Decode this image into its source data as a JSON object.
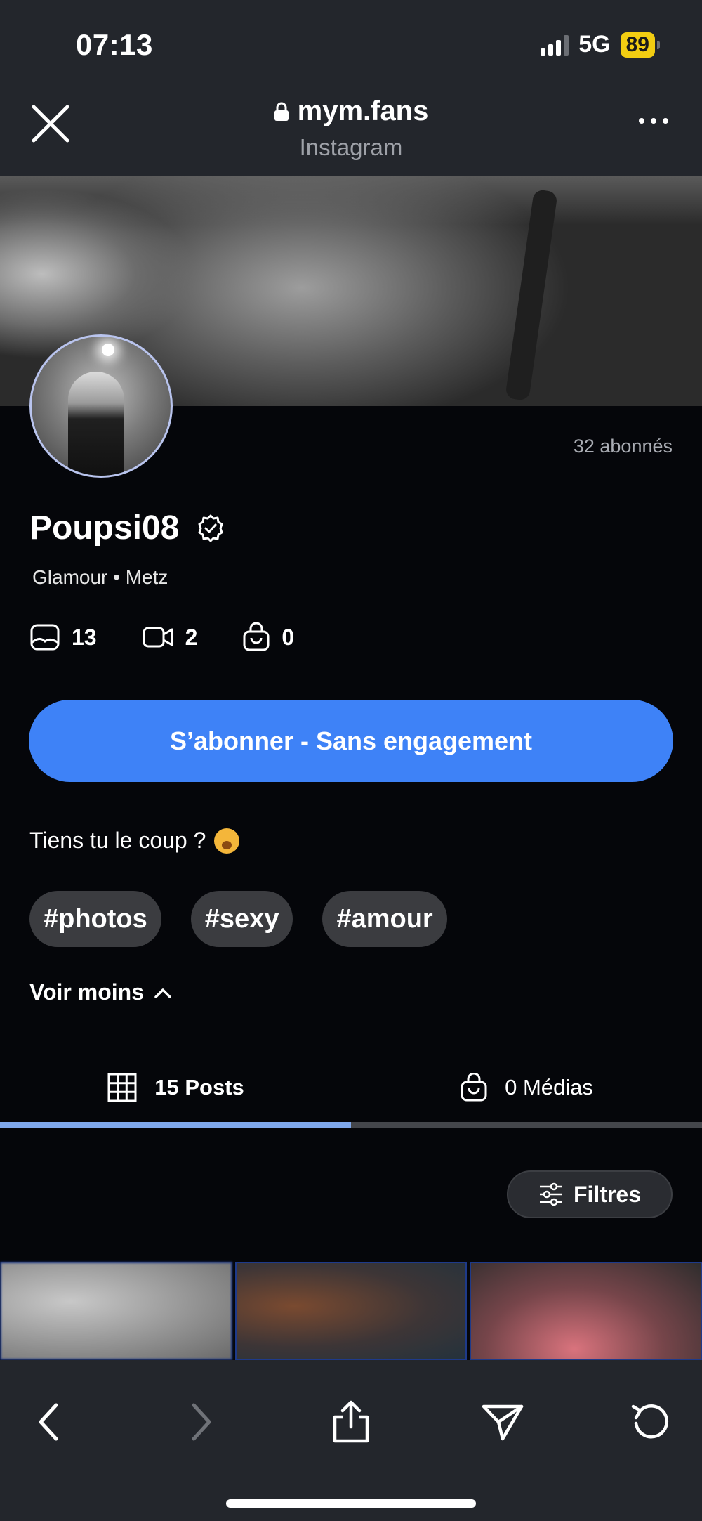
{
  "status_bar": {
    "time": "07:13",
    "network": "5G",
    "battery": "89"
  },
  "browser": {
    "url": "mym.fans",
    "source": "Instagram"
  },
  "profile": {
    "subscribers": "32 abonnés",
    "name": "Poupsi08",
    "meta": "Glamour • Metz",
    "stats": {
      "photos": "13",
      "videos": "2",
      "bag": "0"
    },
    "subscribe_label": "S’abonner - Sans engagement",
    "bio": "Tiens tu le coup ?",
    "tags": [
      "#photos",
      "#sexy",
      "#amour"
    ],
    "see_less": "Voir moins"
  },
  "tabs": [
    {
      "label": "15 Posts",
      "icon": "grid-icon",
      "active": true
    },
    {
      "label": "0 Médias",
      "icon": "shopping-bag-icon",
      "active": false
    }
  ],
  "filters_label": "Filtres",
  "colors": {
    "accent": "#3e82f7",
    "background": "#05060a",
    "chrome": "#23262c",
    "tab_indicator": "#7fa8ec",
    "battery": "#f2cd12"
  }
}
